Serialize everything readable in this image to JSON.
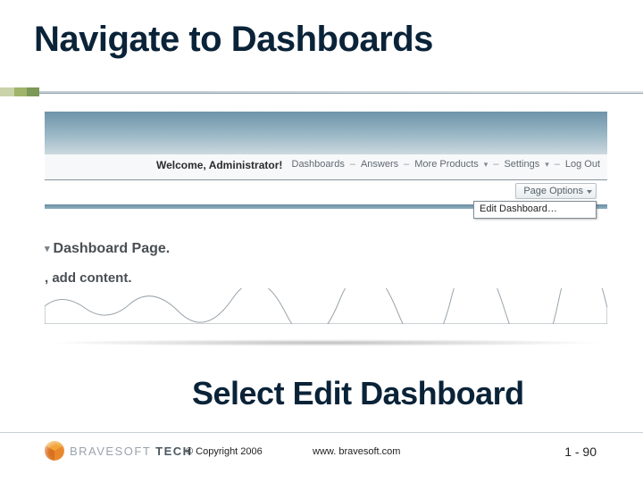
{
  "title": "Navigate to Dashboards",
  "screenshot": {
    "welcome": "Welcome, Administrator!",
    "nav": {
      "dashboards": "Dashboards",
      "answers": "Answers",
      "more_products": "More Products",
      "settings": "Settings",
      "logout": "Log Out"
    },
    "page_options": "Page Options",
    "edit_menu_item": "Edit Dashboard…",
    "body_line1": "Dashboard Page.",
    "body_line2": ", add content."
  },
  "cta": "Select Edit Dashboard",
  "footer": {
    "logo_brand": "BRAVESOFT",
    "logo_suffix": "TECH",
    "copyright": "© Copyright 2006",
    "url": "www. bravesoft.com",
    "page": "1 - 90"
  }
}
